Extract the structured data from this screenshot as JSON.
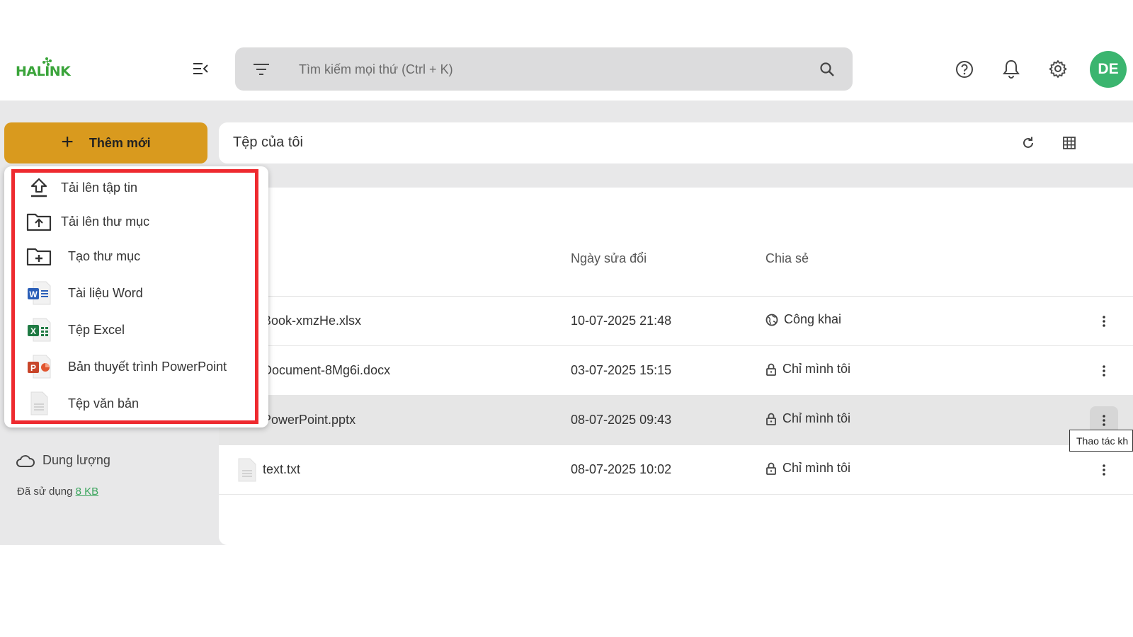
{
  "logo": {
    "text": "HALINK"
  },
  "search": {
    "placeholder": "Tìm kiếm mọi thứ (Ctrl + K)"
  },
  "user": {
    "initials": "DE",
    "avatar_color": "#3bb56f"
  },
  "add_button": {
    "label": "Thêm mới",
    "color": "#d99a1e"
  },
  "dropdown": {
    "highlight_color": "#ee2a2f",
    "items": [
      {
        "label": "Tải lên tập tin",
        "icon": "upload-icon"
      },
      {
        "label": "Tải lên thư mục",
        "icon": "folder-upload-icon"
      },
      {
        "label": "Tạo thư mục",
        "icon": "folder-add-icon"
      },
      {
        "label": "Tài liệu Word",
        "icon": "word-icon"
      },
      {
        "label": "Tệp Excel",
        "icon": "excel-icon"
      },
      {
        "label": "Bản thuyết trình PowerPoint",
        "icon": "powerpoint-icon"
      },
      {
        "label": "Tệp văn bản",
        "icon": "text-file-icon"
      }
    ]
  },
  "storage": {
    "label": "Dung lượng",
    "used_prefix": "Đã sử dụng",
    "used_value": "8 KB"
  },
  "main": {
    "title": "Tệp của tôi",
    "columns": {
      "modified": "Ngày sửa đổi",
      "share": "Chia sẻ"
    },
    "rows": [
      {
        "name": "Book-xmzHe.xlsx",
        "modified": "10-07-2025 21:48",
        "share": "Công khai",
        "share_icon": "globe-icon"
      },
      {
        "name": "Document-8Mg6i.docx",
        "modified": "03-07-2025 15:15",
        "share": "Chỉ mình tôi",
        "share_icon": "lock-icon"
      },
      {
        "name": "PowerPoint.pptx",
        "modified": "08-07-2025 09:43",
        "share": "Chỉ mình tôi",
        "share_icon": "lock-icon"
      },
      {
        "name": "text.txt",
        "modified": "08-07-2025 10:02",
        "share": "Chỉ mình tôi",
        "share_icon": "lock-icon"
      }
    ],
    "tooltip": "Thao tác kh"
  }
}
